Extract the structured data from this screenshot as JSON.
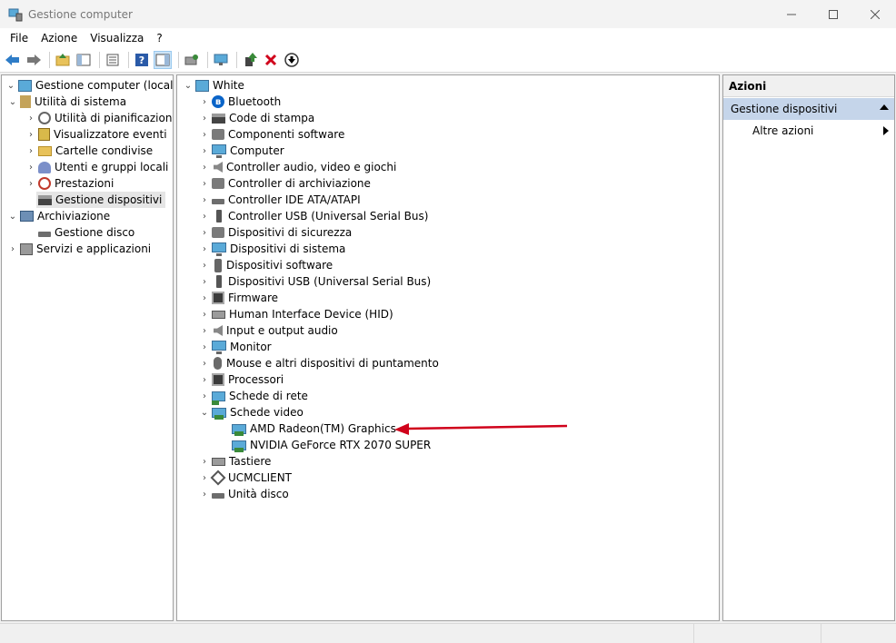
{
  "window": {
    "title": "Gestione computer",
    "controls": [
      "minimize",
      "maximize",
      "close"
    ]
  },
  "menu": [
    "File",
    "Azione",
    "Visualizza",
    "?"
  ],
  "toolbar": {
    "buttons": [
      "back",
      "forward",
      "up-folder",
      "show-hide-tree",
      "properties",
      "help",
      "show-hide-action",
      "export",
      "monitor",
      "update-driver",
      "uninstall",
      "disable"
    ],
    "colors": {
      "uninstall": "#d0021b",
      "nav": "#2e7cc7"
    }
  },
  "left_tree": {
    "root": "Gestione computer (locale)",
    "system_tools": "Utilità di sistema",
    "task_scheduler": "Utilità di pianificazione",
    "event_viewer": "Visualizzatore eventi",
    "shared_folders": "Cartelle condivise",
    "local_users": "Utenti e gruppi locali",
    "performance": "Prestazioni",
    "device_manager": "Gestione dispositivi",
    "storage": "Archiviazione",
    "disk_management": "Gestione disco",
    "services_apps": "Servizi e applicazioni"
  },
  "device_tree": {
    "root": "White",
    "categories": [
      "Bluetooth",
      "Code di stampa",
      "Componenti software",
      "Computer",
      "Controller audio, video e giochi",
      "Controller di archiviazione",
      "Controller IDE ATA/ATAPI",
      "Controller USB (Universal Serial Bus)",
      "Dispositivi di sicurezza",
      "Dispositivi di sistema",
      "Dispositivi software",
      "Dispositivi USB (Universal Serial Bus)",
      "Firmware",
      "Human Interface Device (HID)",
      "Input e output audio",
      "Monitor",
      "Mouse e altri dispositivi di puntamento",
      "Processori",
      "Schede di rete",
      "Schede video",
      "Tastiere",
      "UCMCLIENT",
      "Unità disco"
    ],
    "video_adapters": [
      "AMD Radeon(TM) Graphics",
      "NVIDIA GeForce RTX 2070 SUPER"
    ],
    "annotation_arrow_color": "#d0021b"
  },
  "actions": {
    "header": "Azioni",
    "section": "Gestione dispositivi",
    "more": "Altre azioni"
  }
}
